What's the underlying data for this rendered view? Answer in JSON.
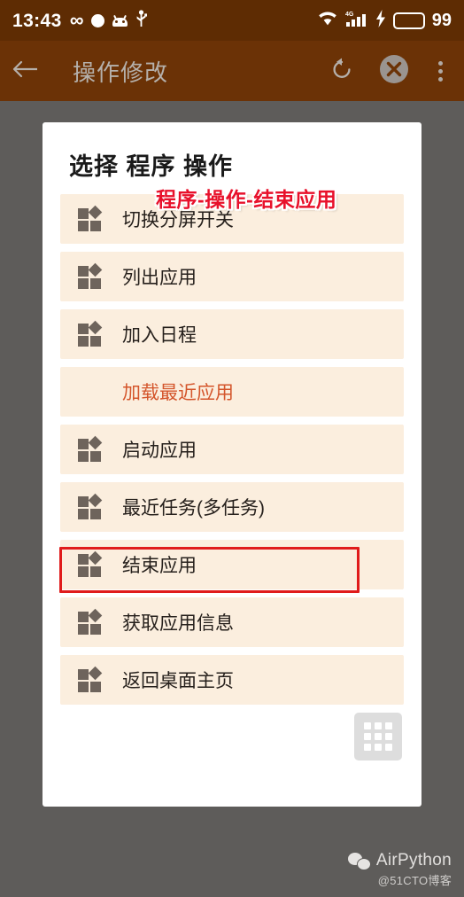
{
  "status_bar": {
    "time": "13:43",
    "battery_percent": "99",
    "icons": [
      "infinity-icon",
      "circle-dot-icon",
      "android-robot-icon",
      "usb-icon",
      "wifi-icon",
      "cellular-4g-icon",
      "charging-bolt-icon",
      "battery-icon"
    ],
    "network_label": "4G",
    "background_color": "#5e2c03"
  },
  "app_bar": {
    "back_label": "←",
    "title": "操作修改",
    "actions": [
      "undo-icon",
      "close-circle-icon",
      "overflow-menu-icon"
    ],
    "background_color": "#6b3206",
    "title_color": "#b5b0ab"
  },
  "dialog": {
    "title": "选择 程序 操作",
    "row_background": "#fbeede",
    "items": [
      {
        "label": "切换分屏开关",
        "has_icon": true,
        "highlighted": false
      },
      {
        "label": "列出应用",
        "has_icon": true,
        "highlighted": false
      },
      {
        "label": "加入日程",
        "has_icon": true,
        "highlighted": false
      },
      {
        "label": "加载最近应用",
        "has_icon": false,
        "highlighted": false
      },
      {
        "label": "启动应用",
        "has_icon": true,
        "highlighted": false
      },
      {
        "label": "最近任务(多任务)",
        "has_icon": true,
        "highlighted": false
      },
      {
        "label": "结束应用",
        "has_icon": true,
        "highlighted": true
      },
      {
        "label": "获取应用信息",
        "has_icon": true,
        "highlighted": false
      },
      {
        "label": "返回桌面主页",
        "has_icon": true,
        "highlighted": false
      }
    ],
    "grid_button_icon": "apps-grid-icon"
  },
  "annotation": {
    "text": "程序-操作-结束应用",
    "color": "#e8112b",
    "highlight_box_color": "#e01b1b"
  },
  "watermark": {
    "icon": "wechat-icon",
    "name": "AirPython",
    "subtitle": "@51CTO博客"
  }
}
